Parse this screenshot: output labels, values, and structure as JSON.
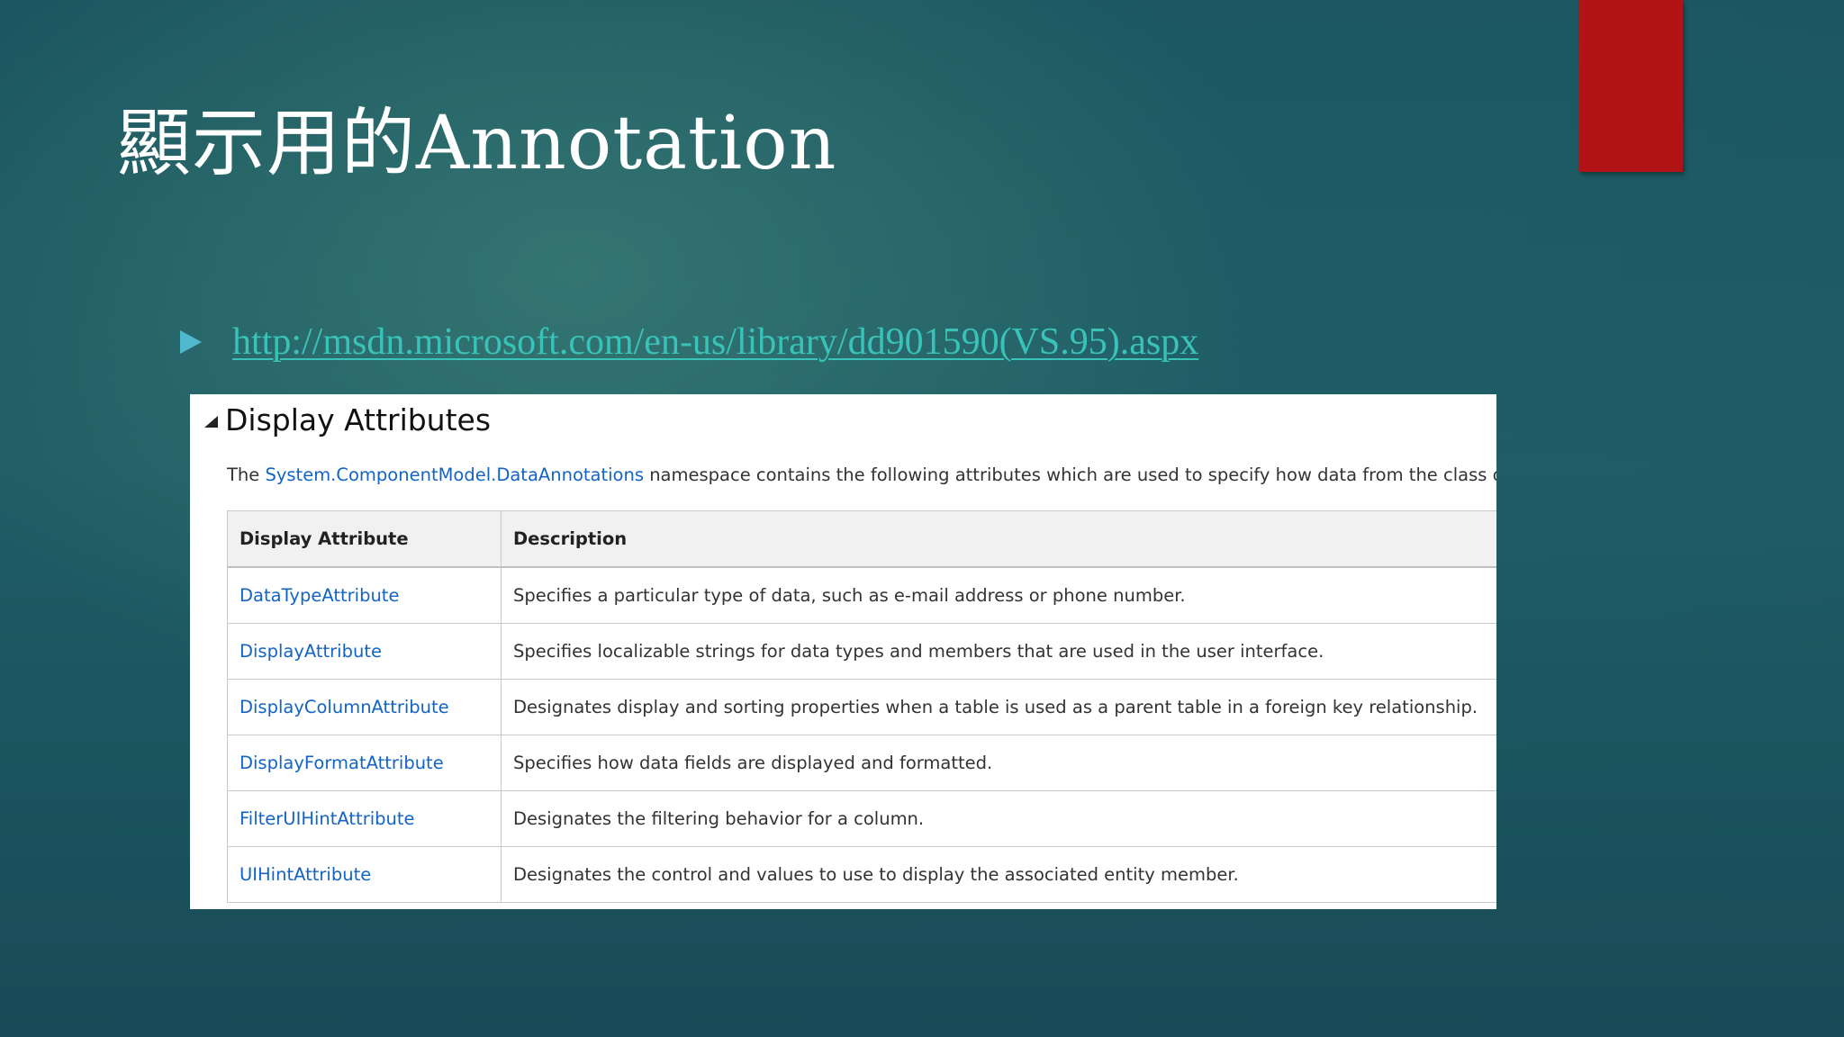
{
  "slide": {
    "title": "顯示用的Annotation",
    "bullet_link": "http://msdn.microsoft.com/en-us/library/dd901590(VS.95).aspx",
    "accent_color": "#b21415"
  },
  "doc": {
    "heading": "Display Attributes",
    "intro": {
      "prefix": "The ",
      "namespace_link": "System.ComponentModel.DataAnnotations",
      "suffix": " namespace contains the following attributes which are used to specify how data from the class or meml"
    },
    "table": {
      "headers": [
        "Display Attribute",
        "Description"
      ],
      "rows": [
        {
          "attribute": "DataTypeAttribute",
          "description": "Specifies a particular type of data, such as e-mail address or phone number."
        },
        {
          "attribute": "DisplayAttribute",
          "description": "Specifies localizable strings for data types and members that are used in the user interface."
        },
        {
          "attribute": "DisplayColumnAttribute",
          "description": "Designates display and sorting properties when a table is used as a parent table in a foreign key relationship."
        },
        {
          "attribute": "DisplayFormatAttribute",
          "description": "Specifies how data fields are displayed and formatted."
        },
        {
          "attribute": "FilterUIHintAttribute",
          "description": "Designates the filtering behavior for a column."
        },
        {
          "attribute": "UIHintAttribute",
          "description": "Designates the control and values to use to display the associated entity member."
        }
      ]
    },
    "link_color": "#1364c4"
  }
}
